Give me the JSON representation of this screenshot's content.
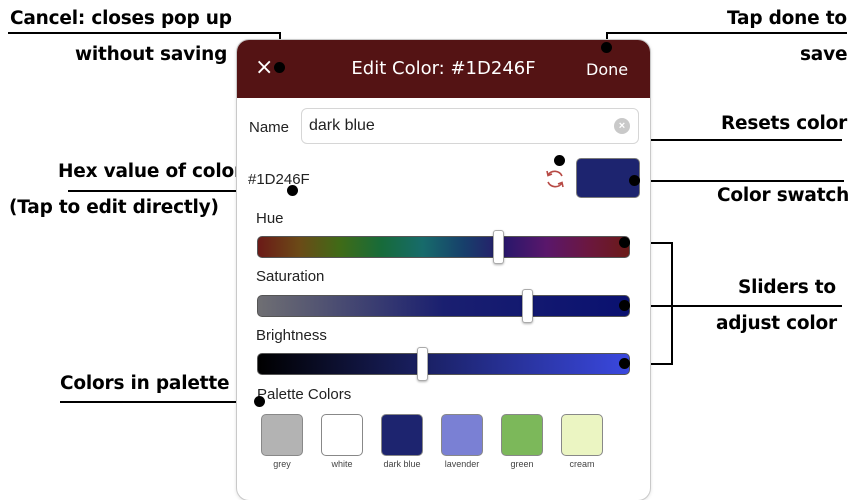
{
  "annotations": {
    "cancel": [
      "Cancel: closes pop up",
      "without saving"
    ],
    "done": [
      "Tap done to",
      "save"
    ],
    "resets": "Resets color",
    "hex": [
      "Hex value of color",
      "(Tap to edit directly)"
    ],
    "swatch": "Color swatch",
    "sliders": [
      "Sliders to",
      "adjust color"
    ],
    "palette": "Colors in palette"
  },
  "dialog": {
    "close_glyph": "×",
    "title": "Edit Color: #1D246F",
    "done_label": "Done",
    "name_label": "Name",
    "name_value": "dark blue",
    "clear_glyph": "×",
    "hex_value": "#1D246F",
    "current_color": "#1D246F",
    "header_color": "#541314"
  },
  "sliders": [
    {
      "label": "Hue",
      "value": 0.65
    },
    {
      "label": "Saturation",
      "value": 0.73
    },
    {
      "label": "Brightness",
      "value": 0.44
    }
  ],
  "palette": {
    "label": "Palette Colors",
    "colors": [
      {
        "name": "grey",
        "hex": "#B3B3B3"
      },
      {
        "name": "white",
        "hex": "#FFFFFF"
      },
      {
        "name": "dark blue",
        "hex": "#1D246F"
      },
      {
        "name": "lavender",
        "hex": "#7A80D4"
      },
      {
        "name": "green",
        "hex": "#7CB85A"
      },
      {
        "name": "cream",
        "hex": "#EBF5C2"
      }
    ]
  },
  "icons": [
    "close-icon",
    "clear-icon",
    "reset-icon"
  ]
}
